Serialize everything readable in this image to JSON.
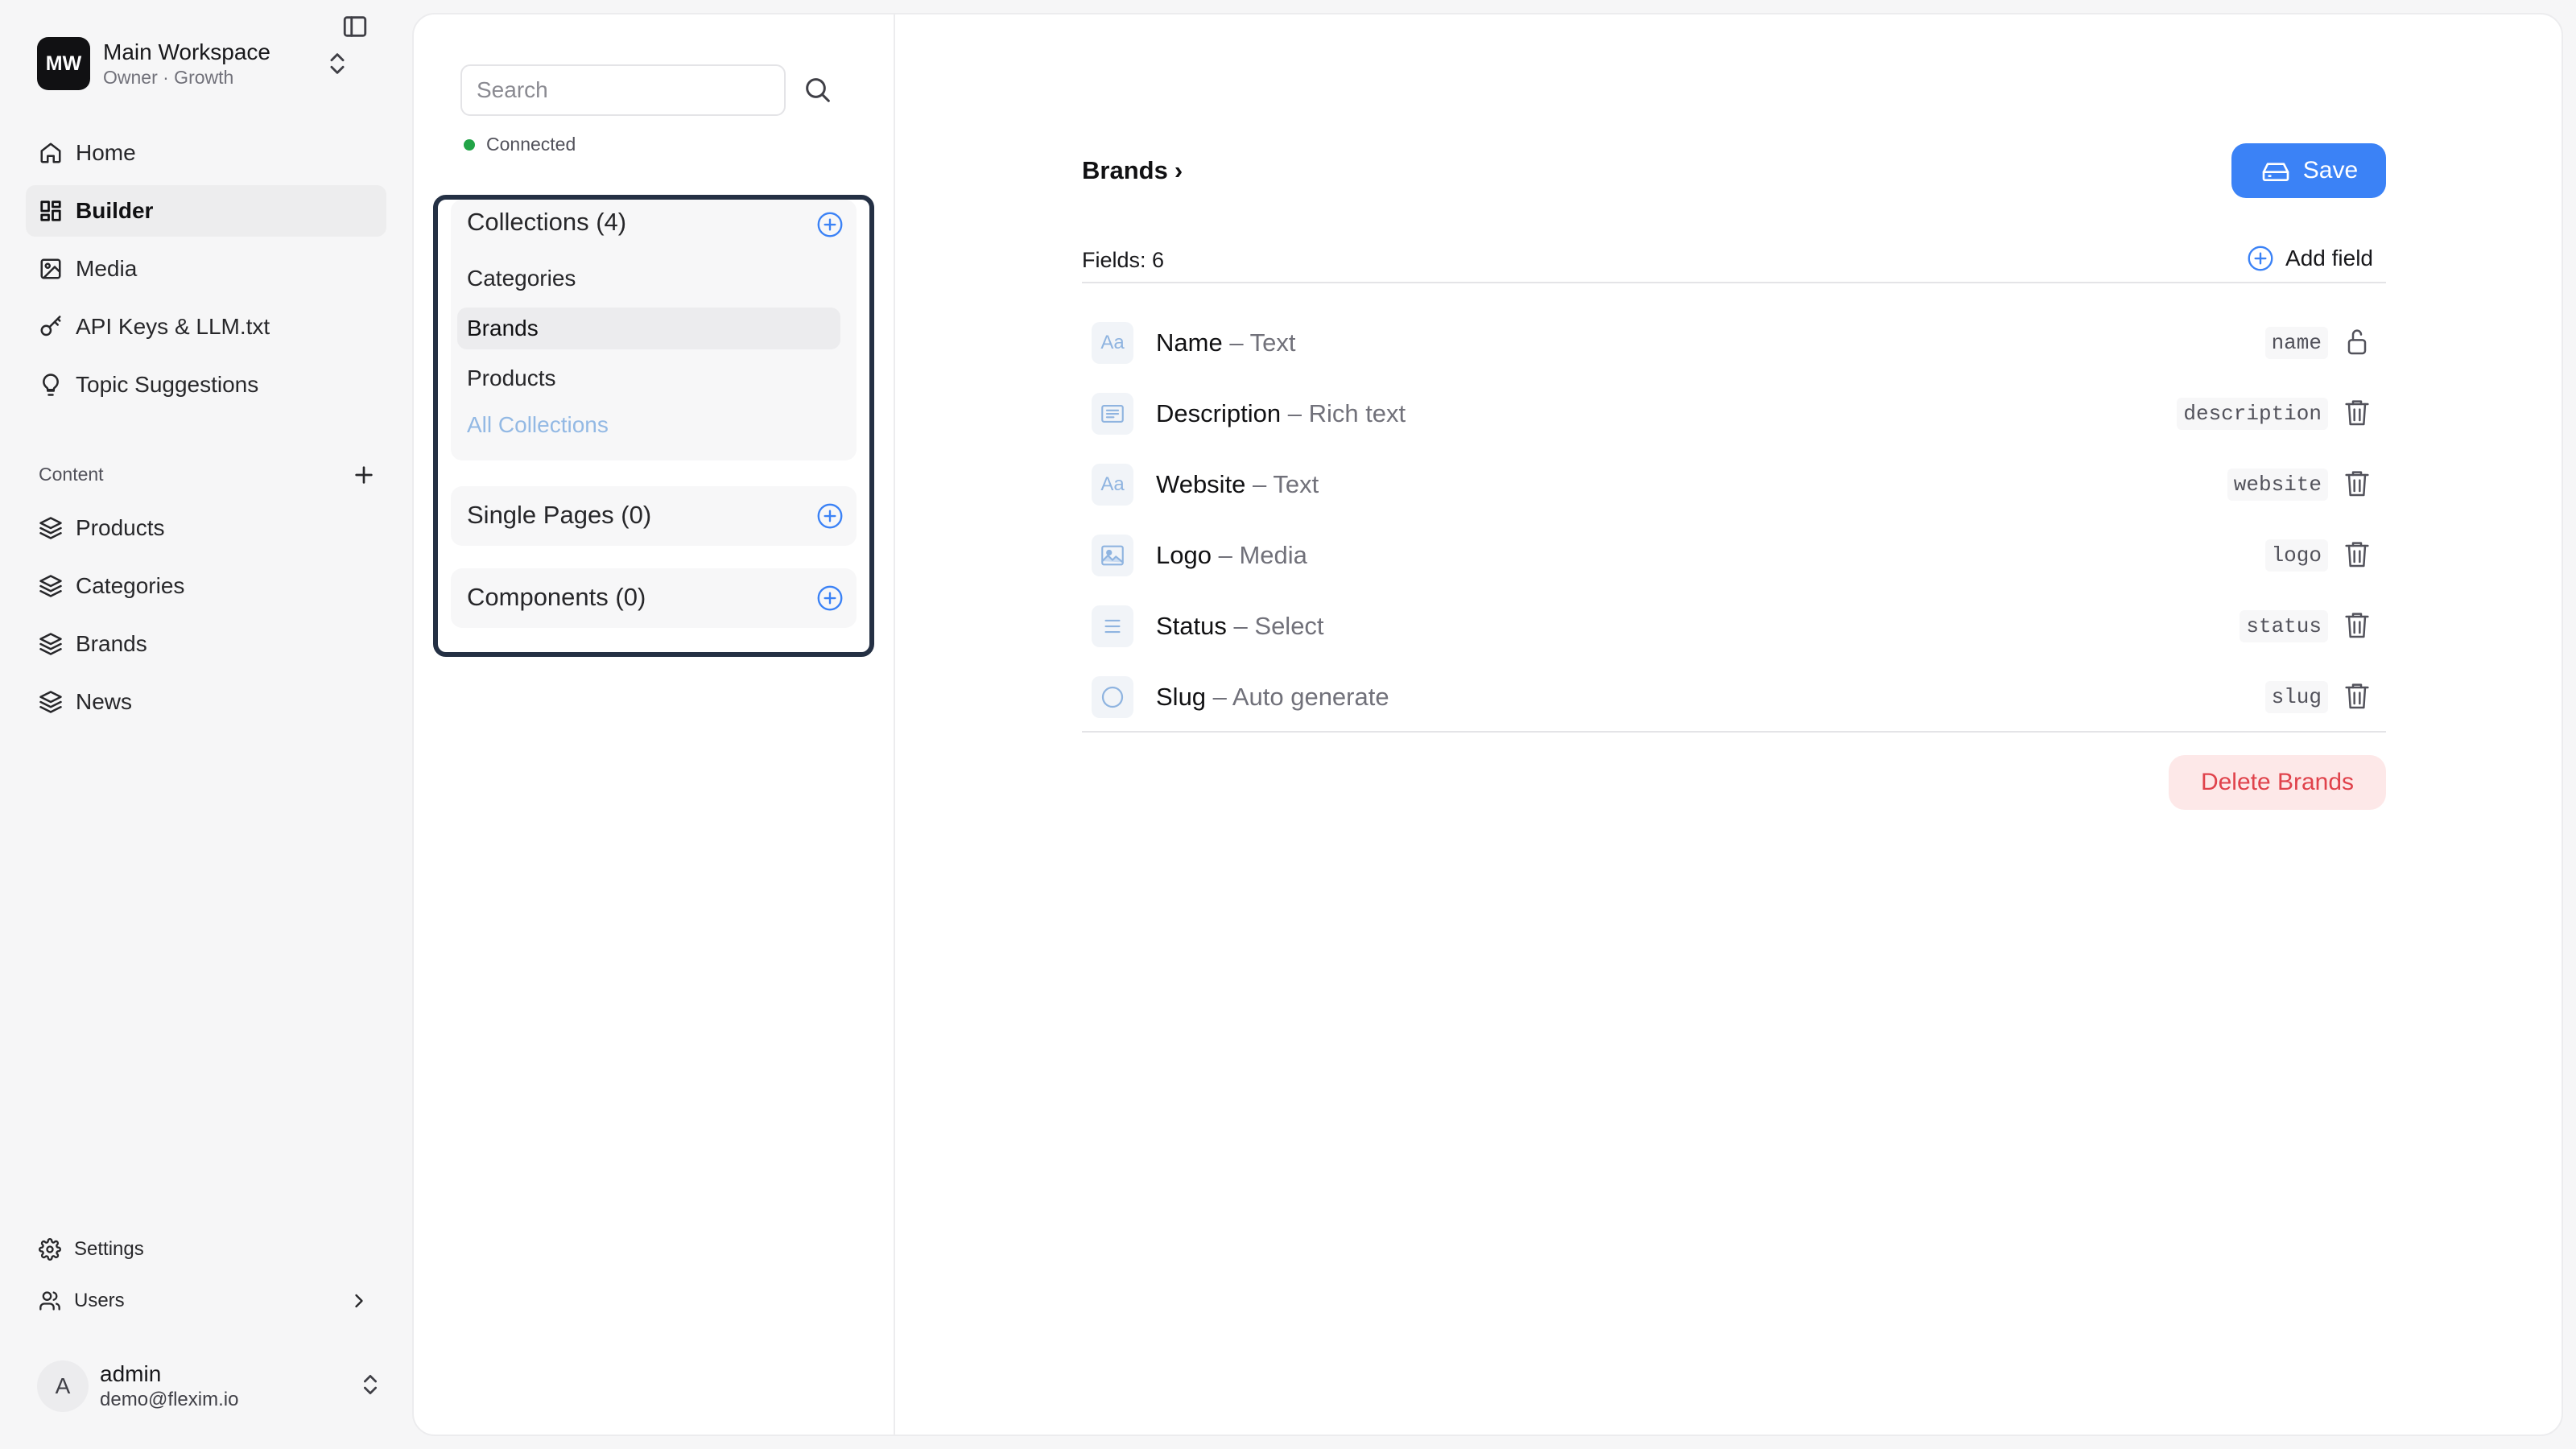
{
  "workspace": {
    "logo": "MW",
    "name": "Main Workspace",
    "plan": "Owner · Growth"
  },
  "nav": {
    "items": [
      {
        "label": "Home",
        "icon": "home-icon"
      },
      {
        "label": "Builder",
        "icon": "grid-icon",
        "active": true
      },
      {
        "label": "Media",
        "icon": "image-icon"
      },
      {
        "label": "API Keys & LLM.txt",
        "icon": "key-icon"
      },
      {
        "label": "Topic Suggestions",
        "icon": "lightbulb-icon"
      }
    ],
    "content_label": "Content",
    "content_items": [
      {
        "label": "Products",
        "icon": "layers-icon"
      },
      {
        "label": "Categories",
        "icon": "layers-icon"
      },
      {
        "label": "Brands",
        "icon": "layers-icon"
      },
      {
        "label": "News",
        "icon": "layers-icon"
      }
    ],
    "footer_items": [
      {
        "label": "Settings",
        "icon": "gear-icon"
      },
      {
        "label": "Users",
        "icon": "users-icon"
      }
    ]
  },
  "user": {
    "initial": "A",
    "name": "admin",
    "email": "demo@flexim.io"
  },
  "schema": {
    "search_placeholder": "Search",
    "search_value": "",
    "status": "Connected",
    "collections_title": "Collections (4)",
    "collections": [
      "Categories",
      "Brands",
      "Products"
    ],
    "active_collection": "Brands",
    "all_collections": "All Collections",
    "single_pages_title": "Single Pages (0)",
    "components_title": "Components (0)"
  },
  "editor": {
    "breadcrumb": "Brands",
    "breadcrumb_sep": "›",
    "save_label": "Save",
    "fields_count": "Fields: 6",
    "add_field_label": "Add field",
    "fields": [
      {
        "name": "Name",
        "type": "Text",
        "key": "name",
        "icon": "text-type-icon",
        "glyph": "Aa",
        "action": "lock-icon"
      },
      {
        "name": "Description",
        "type": "Rich text",
        "key": "description",
        "icon": "rich-text-icon",
        "action": "trash-icon"
      },
      {
        "name": "Website",
        "type": "Text",
        "key": "website",
        "icon": "text-type-icon",
        "glyph": "Aa",
        "action": "trash-icon"
      },
      {
        "name": "Logo",
        "type": "Media",
        "key": "logo",
        "icon": "media-icon",
        "action": "trash-icon"
      },
      {
        "name": "Status",
        "type": "Select",
        "key": "status",
        "icon": "select-icon",
        "action": "trash-icon"
      },
      {
        "name": "Slug",
        "type": "Auto generate",
        "key": "slug",
        "icon": "auto-generate-icon",
        "action": "trash-icon"
      }
    ],
    "field_separator": "–",
    "delete_label": "Delete Brands"
  },
  "colors": {
    "accent": "#3b82f6",
    "status_ok": "#22a447",
    "danger": "#e0424b",
    "danger_bg": "#fde8e8",
    "highlight_border": "#243044"
  }
}
